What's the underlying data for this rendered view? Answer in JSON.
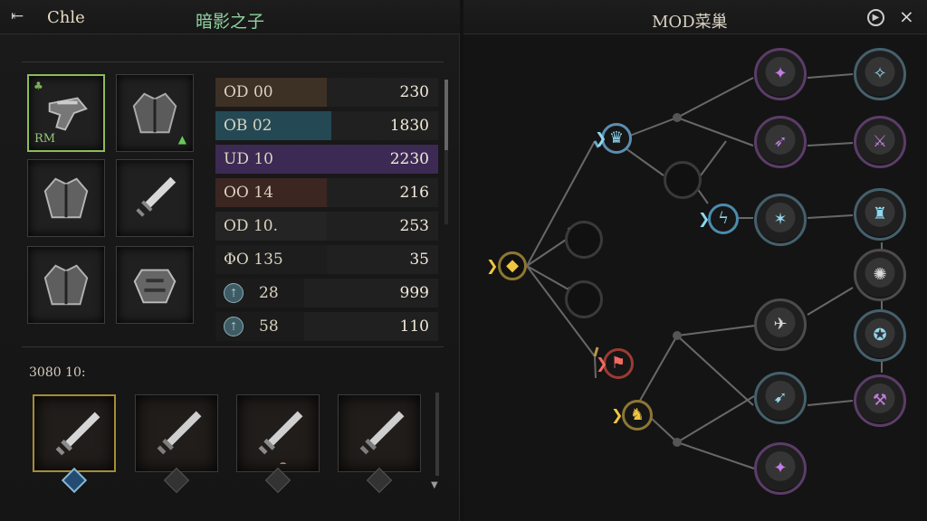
{
  "header": {
    "back_label": "⇤",
    "app_title": "Chle",
    "character_title": "暗影之子",
    "mod_title": "MOD菜巢",
    "info_icon": "play-circle-icon",
    "close_label": "×"
  },
  "equipment": [
    {
      "name": "rifle",
      "label": "RM",
      "selected": true
    },
    {
      "name": "jacket-upgrade",
      "upgrade": "▲"
    },
    {
      "name": "jacket"
    },
    {
      "name": "sword"
    },
    {
      "name": "jacket-alt"
    },
    {
      "name": "armor"
    }
  ],
  "stats": [
    {
      "name": "OD 00",
      "value": "230",
      "color": "#3d3126",
      "fill": 0.5
    },
    {
      "name": "OB 02",
      "value": "1830",
      "color": "#244954",
      "fill": 0.52
    },
    {
      "name": "UD 10",
      "value": "2230",
      "color": "#3c2a54",
      "fill": 1.0
    },
    {
      "name": "OO 14",
      "value": "216",
      "color": "#3b2622",
      "fill": 0.5
    },
    {
      "name": "OD 10.",
      "value": "253",
      "color": "#242424",
      "fill": 0.5
    },
    {
      "name": "ΦO 135",
      "value": "35",
      "color": "#1d1d1d",
      "fill": 0.5
    },
    {
      "name": "28",
      "value": "999",
      "color": "#1b1b1b",
      "fill": 0.4,
      "icon": "bird-icon"
    },
    {
      "name": "58",
      "value": "110",
      "color": "#1b1b1b",
      "fill": 0.4,
      "icon": "claw-icon"
    }
  ],
  "weapons_section": {
    "title": "3080 10:",
    "items": [
      {
        "name": "weapon-sword-1",
        "selected": true
      },
      {
        "name": "weapon-sword-2"
      },
      {
        "name": "weapon-sword-3"
      },
      {
        "name": "weapon-sword-4"
      }
    ]
  },
  "mod_tree": {
    "nodes": [
      {
        "id": "root",
        "icon": "◆",
        "color": "gold"
      },
      {
        "id": "blue-top",
        "icon": "♛",
        "color": "blue"
      },
      {
        "id": "blue-mid",
        "icon": "ϟ",
        "color": "blue"
      },
      {
        "id": "red",
        "icon": "⚑",
        "color": "red"
      },
      {
        "id": "gold-low",
        "icon": "♞",
        "color": "gold"
      },
      {
        "id": "mod-1",
        "icon": "✦",
        "color": "pink"
      },
      {
        "id": "mod-2",
        "icon": "➶",
        "color": "pink"
      },
      {
        "id": "mod-3",
        "icon": "✧",
        "color": "blue"
      },
      {
        "id": "mod-4",
        "icon": "⚔",
        "color": "blue"
      },
      {
        "id": "mod-5",
        "icon": "✶",
        "color": "pink"
      },
      {
        "id": "mod-6",
        "icon": "♜",
        "color": "white"
      },
      {
        "id": "mod-7",
        "icon": "✺",
        "color": "blue"
      },
      {
        "id": "mod-8",
        "icon": "✈",
        "color": "blue"
      },
      {
        "id": "mod-9",
        "icon": "✪",
        "color": "pink"
      },
      {
        "id": "mod-10",
        "icon": "➹",
        "color": "blue"
      },
      {
        "id": "mod-11",
        "icon": "⚒",
        "color": "white"
      },
      {
        "id": "mod-12",
        "icon": "✦",
        "color": "pink"
      }
    ]
  }
}
